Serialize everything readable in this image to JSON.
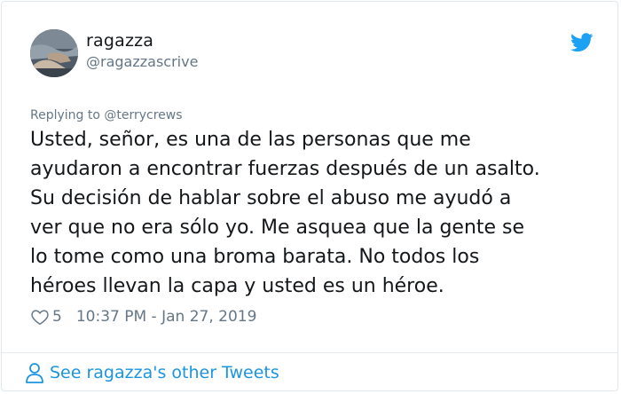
{
  "author": {
    "display_name": "ragazza",
    "handle": "@ragazzascrive",
    "avatar_icon": "profile-photo"
  },
  "reply": {
    "label": "Replying to @terrycrews"
  },
  "tweet": {
    "text": "Usted, señor, es una de las personas que me\nayudaron a encontrar fuerzas después de un asalto.\nSu decisión de hablar sobre el abuso me ayudó a\nver que no era sólo yo. Me asquea que la gente se\nlo tome como una broma barata. No todos los\nhéroes llevan la capa y usted es un héroe.",
    "likes": "5",
    "timestamp": "10:37 PM - Jan 27, 2019"
  },
  "footer": {
    "link_label": "See ragazza's other Tweets"
  },
  "colors": {
    "brand": "#1da1f2",
    "link": "#1b95e0",
    "muted": "#657786"
  },
  "icons": [
    "twitter-bird-icon",
    "heart-icon",
    "person-icon"
  ]
}
